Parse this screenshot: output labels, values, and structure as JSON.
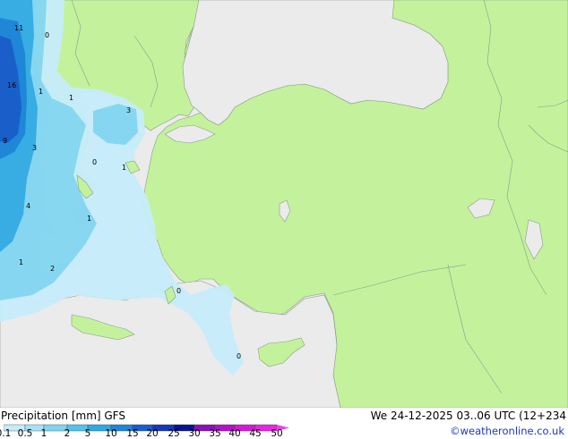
{
  "map": {
    "values": [
      {
        "text": "11"
      },
      {
        "text": "0"
      },
      {
        "text": "16"
      },
      {
        "text": "1"
      },
      {
        "text": "1"
      },
      {
        "text": "3"
      },
      {
        "text": "9"
      },
      {
        "text": "3"
      },
      {
        "text": "0"
      },
      {
        "text": "1"
      },
      {
        "text": "4"
      },
      {
        "text": "1"
      },
      {
        "text": "1"
      },
      {
        "text": "2"
      },
      {
        "text": "0"
      },
      {
        "text": "0"
      }
    ]
  },
  "footer": {
    "title": "Precipitation [mm]  GFS",
    "valid": "We 24-12-2025 03..06 UTC (12+234",
    "site": "©weatheronline.co.uk"
  },
  "legend": {
    "ticks": [
      "0.1",
      "0.5",
      "1",
      "2",
      "5",
      "10",
      "15",
      "20",
      "25",
      "30",
      "35",
      "40",
      "45",
      "50"
    ],
    "colors": [
      "#c6ecfa",
      "#a6e2f6",
      "#7fd4f0",
      "#55c2ea",
      "#2fa9e1",
      "#1f86d8",
      "#1a5fc9",
      "#1639b4",
      "#0a148c",
      "#8a10b8",
      "#b412c8",
      "#d21ad6",
      "#e428e0",
      "#f040e8"
    ]
  }
}
